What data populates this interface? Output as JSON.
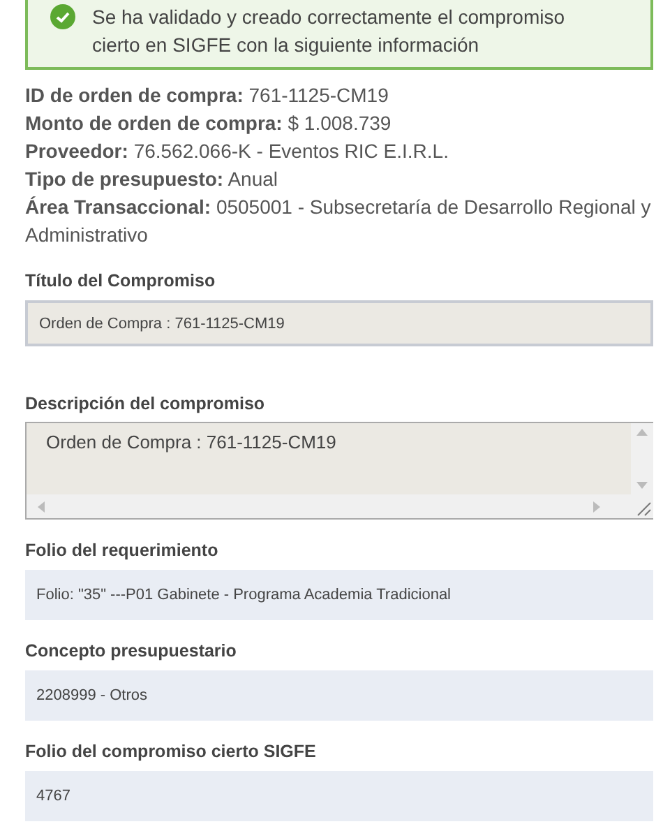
{
  "alert": {
    "message": "Se ha validado y creado correctamente el compromiso cierto en SIGFE con la siguiente información"
  },
  "details": [
    {
      "label": "ID de orden de compra:",
      "value": "761-1125-CM19"
    },
    {
      "label": "Monto de orden de compra:",
      "value": "$ 1.008.739"
    },
    {
      "label": "Proveedor:",
      "value": "76.562.066-K - Eventos RIC E.I.R.L."
    },
    {
      "label": "Tipo de presupuesto:",
      "value": "Anual"
    },
    {
      "label": "Área Transaccional:",
      "value": "0505001 - Subsecretaría de Desarrollo Regional y Administrativo"
    }
  ],
  "fields": [
    {
      "kind": "input",
      "label": "Título del Compromiso",
      "value": "Orden de Compra : 761-1125-CM19"
    },
    {
      "kind": "textarea",
      "label": "Descripción del compromiso",
      "value": "Orden de Compra : 761-1125-CM19"
    },
    {
      "kind": "readonly",
      "label": "Folio del requerimiento",
      "value": "Folio: \"35\" ---P01 Gabinete - Programa Academia Tradicional"
    },
    {
      "kind": "readonly",
      "label": "Concepto presupuestario",
      "value": "2208999 - Otros"
    },
    {
      "kind": "readonly",
      "label": "Folio del compromiso cierto SIGFE",
      "value": "4767"
    }
  ]
}
